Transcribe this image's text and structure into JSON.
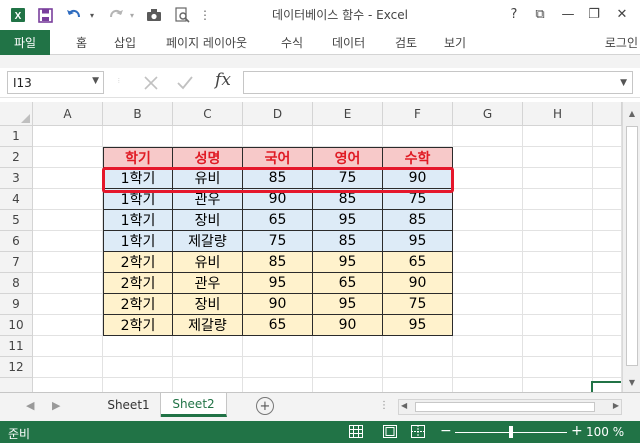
{
  "window": {
    "title": "데이터베이스 함수 - Excel",
    "help": "?",
    "ribbon_toggle": "⧉",
    "minimize": "—",
    "restore": "❐",
    "close": "✕"
  },
  "qat": {
    "save": "💾",
    "undo": "↶",
    "redo": "↷",
    "more": "⋮"
  },
  "ribbon": {
    "file": "파일",
    "tabs": [
      "홈",
      "삽입",
      "페이지 레이아웃",
      "수식",
      "데이터",
      "검토",
      "보기"
    ],
    "login": "로그인"
  },
  "formula_bar": {
    "name_box": "I13",
    "formula": ""
  },
  "columns": [
    "A",
    "B",
    "C",
    "D",
    "E",
    "F",
    "G",
    "H"
  ],
  "rows": [
    "1",
    "2",
    "3",
    "4",
    "5",
    "6",
    "7",
    "8",
    "9",
    "10",
    "11",
    "12"
  ],
  "table": {
    "headers": [
      "학기",
      "성명",
      "국어",
      "영어",
      "수학"
    ],
    "rows": [
      [
        "1학기",
        "유비",
        "85",
        "75",
        "90"
      ],
      [
        "1학기",
        "관우",
        "90",
        "85",
        "75"
      ],
      [
        "1학기",
        "장비",
        "65",
        "95",
        "85"
      ],
      [
        "1학기",
        "제갈량",
        "75",
        "85",
        "95"
      ],
      [
        "2학기",
        "유비",
        "85",
        "95",
        "65"
      ],
      [
        "2학기",
        "관우",
        "95",
        "65",
        "90"
      ],
      [
        "2학기",
        "장비",
        "90",
        "95",
        "75"
      ],
      [
        "2학기",
        "제갈량",
        "65",
        "90",
        "95"
      ]
    ]
  },
  "colors": {
    "accent": "#217346",
    "header_fill": "#f7c9c9",
    "header_text": "#e01b24",
    "sem1_fill": "#ddebf7",
    "sem2_fill": "#fff2cc",
    "highlight": "#e5172b"
  },
  "sheets": {
    "tabs": [
      "Sheet1",
      "Sheet2"
    ],
    "active": "Sheet2",
    "add": "+"
  },
  "status": {
    "ready": "준비",
    "zoom_minus": "−",
    "zoom_plus": "+",
    "zoom": "100 %",
    "zoom_fraction": 0.5
  }
}
